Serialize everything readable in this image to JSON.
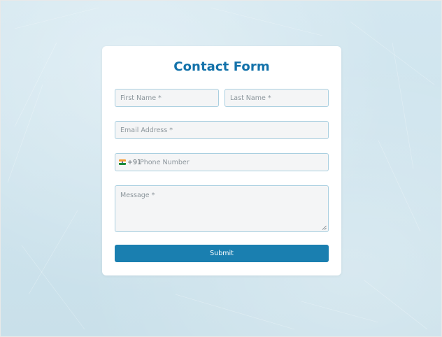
{
  "form": {
    "title": "Contact Form",
    "first_name_placeholder": "First Name *",
    "last_name_placeholder": "Last Name *",
    "email_placeholder": "Email Address *",
    "phone": {
      "flag_icon": "india-flag-icon",
      "dial_code": "+91",
      "placeholder": "Phone Number"
    },
    "message_placeholder": "Message *",
    "submit_label": "Submit"
  },
  "colors": {
    "accent": "#1a7fb0",
    "title": "#1372aa",
    "page_background": "#cde4ee",
    "field_background": "#f4f5f6",
    "field_border": "#a9cfe0"
  }
}
